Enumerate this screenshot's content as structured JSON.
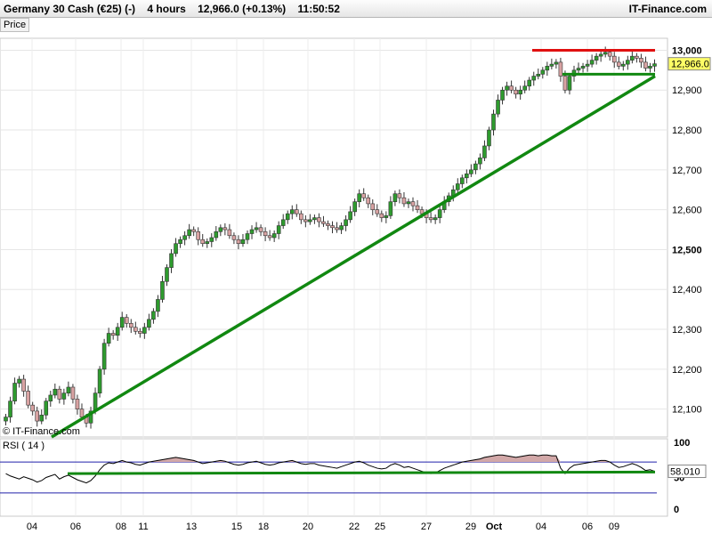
{
  "header": {
    "title": "Germany 30 Cash (€25) (-)",
    "timeframe": "4 hours",
    "quote": "12,966.0 (+0.13%)",
    "time": "11:50:52",
    "brand": "IT-Finance.com"
  },
  "price_tab": "Price",
  "watermark": "© IT-Finance.com",
  "rsi_label": "RSI ( 14 )",
  "colors": {
    "up_candle": "#2e9b2e",
    "down_candle": "#d9a3a3",
    "trendline": "#118811",
    "resistance": "#e01010",
    "rsi_line": "#000000",
    "rsi_band": "#2020aa",
    "rsi_fill": "#d2a8a8"
  },
  "chart_data": [
    {
      "type": "candlestick",
      "title": "Germany 30 Cash (€25) (-)",
      "ylim": [
        12030,
        13030
      ],
      "y_ticks": [
        "12,100",
        "12,200",
        "12,300",
        "12,400",
        "12,500",
        "12,600",
        "12,700",
        "12,800",
        "12,900",
        "13,000"
      ],
      "x_ticks": [
        "04",
        "06",
        "08",
        "11",
        "13",
        "15",
        "18",
        "20",
        "22",
        "25",
        "27",
        "29",
        "Oct",
        "04",
        "06",
        "09"
      ],
      "last_price": "12,966.0",
      "closes": [
        12080,
        12120,
        12165,
        12175,
        12145,
        12110,
        12095,
        12070,
        12085,
        12120,
        12135,
        12150,
        12125,
        12140,
        12155,
        12125,
        12100,
        12080,
        12065,
        12095,
        12140,
        12200,
        12265,
        12290,
        12285,
        12305,
        12330,
        12315,
        12305,
        12295,
        12290,
        12305,
        12325,
        12345,
        12375,
        12420,
        12455,
        12490,
        12515,
        12525,
        12535,
        12550,
        12545,
        12525,
        12515,
        12520,
        12530,
        12545,
        12555,
        12550,
        12535,
        12525,
        12515,
        12525,
        12540,
        12550,
        12555,
        12545,
        12535,
        12530,
        12540,
        12560,
        12575,
        12590,
        12600,
        12590,
        12575,
        12570,
        12575,
        12580,
        12570,
        12565,
        12560,
        12555,
        12550,
        12560,
        12575,
        12595,
        12620,
        12640,
        12630,
        12615,
        12600,
        12590,
        12580,
        12585,
        12620,
        12640,
        12630,
        12615,
        12620,
        12610,
        12600,
        12590,
        12580,
        12575,
        12580,
        12600,
        12620,
        12635,
        12650,
        12665,
        12680,
        12690,
        12700,
        12715,
        12730,
        12760,
        12800,
        12840,
        12875,
        12900,
        12910,
        12900,
        12890,
        12900,
        12910,
        12925,
        12935,
        12940,
        12950,
        12960,
        12965,
        12970,
        12935,
        12900,
        12935,
        12950,
        12955,
        12960,
        12965,
        12975,
        12985,
        12990,
        12995,
        12985,
        12970,
        12960,
        12965,
        12975,
        12985,
        12980,
        12970,
        12955,
        12960,
        12966
      ],
      "annotations": {
        "resistance_line": {
          "from": [
            "Oct",
            13000
          ],
          "to": [
            "09",
            13000
          ]
        },
        "support_line": {
          "from": [
            "04",
            12940
          ],
          "to": [
            "09",
            12940
          ]
        },
        "trendline": {
          "from": [
            "04",
            12030
          ],
          "to": [
            "09",
            12935
          ]
        }
      }
    },
    {
      "type": "line",
      "title": "RSI ( 14 )",
      "ylim": [
        0,
        100
      ],
      "y_ticks": [
        "100",
        "50",
        "0"
      ],
      "bands": [
        70,
        30
      ],
      "last_value": "58.010",
      "values": [
        55,
        52,
        50,
        48,
        51,
        49,
        47,
        44,
        46,
        50,
        52,
        54,
        48,
        51,
        53,
        50,
        47,
        45,
        43,
        46,
        52,
        60,
        66,
        69,
        68,
        70,
        72,
        70,
        69,
        67,
        66,
        68,
        70,
        71,
        72,
        73,
        74,
        75,
        76,
        75,
        74,
        73,
        72,
        70,
        68,
        69,
        70,
        71,
        72,
        71,
        69,
        67,
        66,
        67,
        69,
        70,
        71,
        69,
        67,
        66,
        67,
        69,
        70,
        71,
        72,
        70,
        68,
        67,
        68,
        68,
        66,
        65,
        64,
        63,
        62,
        64,
        66,
        68,
        70,
        71,
        69,
        66,
        64,
        62,
        61,
        62,
        66,
        68,
        66,
        63,
        64,
        62,
        60,
        58,
        56,
        55,
        56,
        59,
        62,
        64,
        66,
        68,
        70,
        71,
        72,
        73,
        74,
        76,
        77,
        78,
        79,
        79,
        78,
        77,
        76,
        77,
        78,
        79,
        79,
        78,
        79,
        79,
        78,
        78,
        62,
        55,
        62,
        66,
        67,
        68,
        69,
        70,
        71,
        72,
        72,
        70,
        66,
        63,
        64,
        66,
        68,
        66,
        63,
        59,
        60,
        58
      ]
    }
  ]
}
